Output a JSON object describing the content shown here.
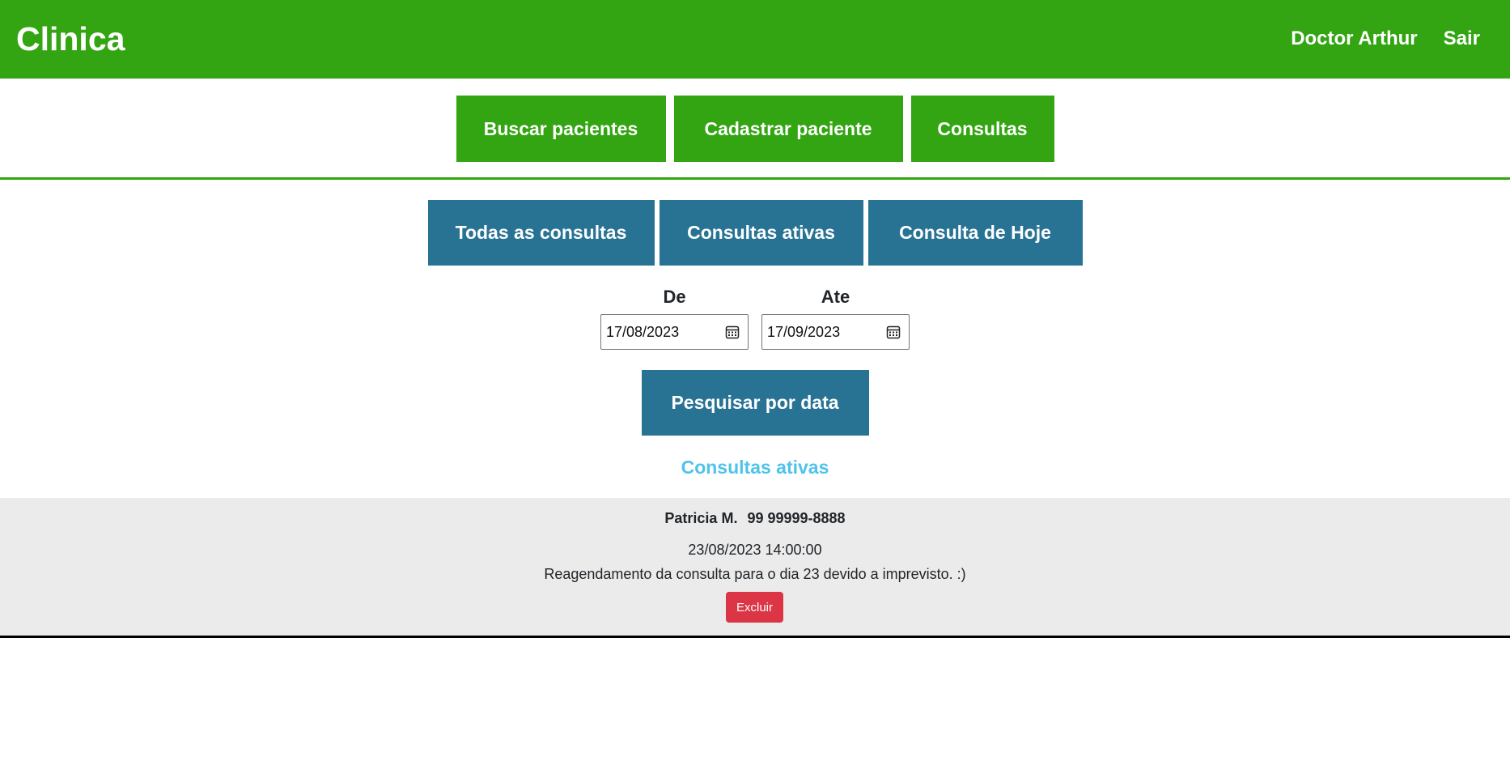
{
  "header": {
    "brand": "Clinica",
    "user_name": "Doctor Arthur",
    "logout_label": "Sair",
    "color": "#33a512"
  },
  "main_nav": {
    "search_patients": "Buscar pacientes",
    "register_patient": "Cadastrar paciente",
    "appointments": "Consultas"
  },
  "filters": {
    "all": "Todas as consultas",
    "active": "Consultas ativas",
    "today": "Consulta de Hoje",
    "color": "#287394"
  },
  "date_range": {
    "from_label": "De",
    "from_value": "17/08/2023",
    "to_label": "Ate",
    "to_value": "17/09/2023",
    "icon": "calendar-icon",
    "search_label": "Pesquisar por data"
  },
  "section_title": "Consultas ativas",
  "appointments": [
    {
      "patient": "Patricia M.",
      "phone": "99 99999-8888",
      "datetime": "23/08/2023 14:00:00",
      "note": "Reagendamento da consulta para o dia 23 devido a imprevisto. :)",
      "delete_label": "Excluir"
    }
  ]
}
